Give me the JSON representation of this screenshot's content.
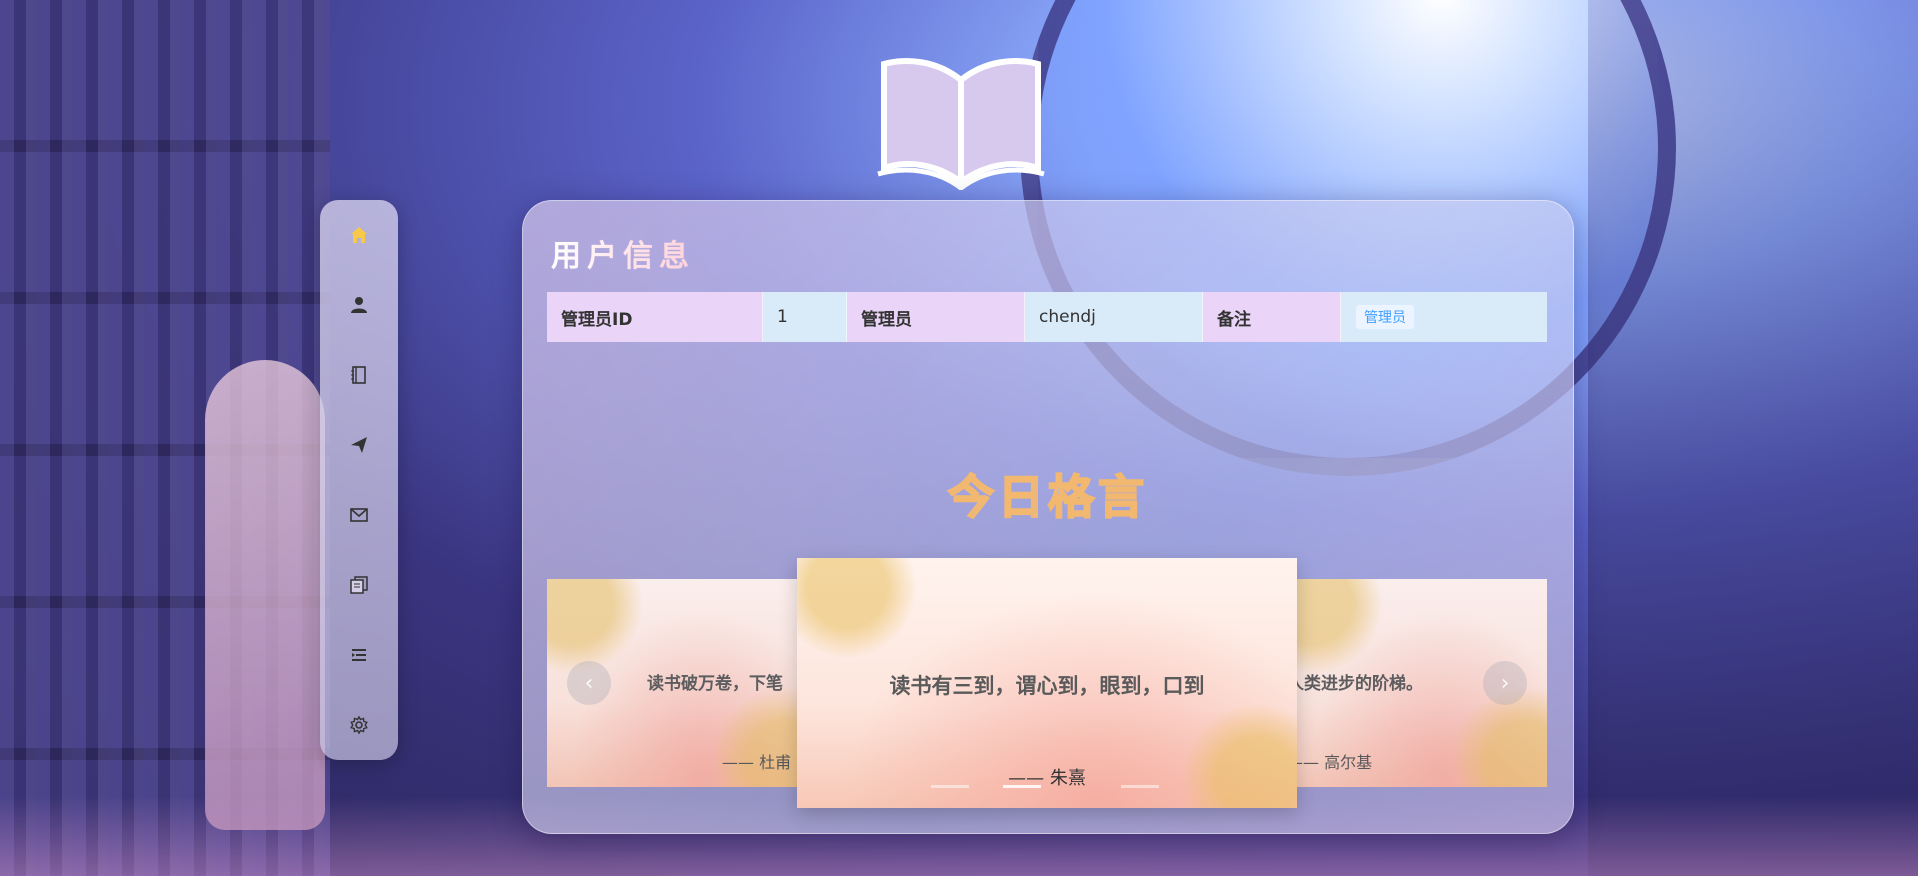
{
  "panel": {
    "title": "用户信息"
  },
  "info_table": [
    {
      "label": "管理员ID",
      "value": "1"
    },
    {
      "label": "管理员",
      "value": "chendj"
    },
    {
      "label": "备注",
      "tag": "管理员"
    }
  ],
  "motto": {
    "heading": "今日格言",
    "cards": [
      {
        "quote": "读书破万卷，下笔",
        "author": "—— 杜甫"
      },
      {
        "quote": "读书有三到，谓心到，眼到，口到",
        "author": "—— 朱熹"
      },
      {
        "quote": "人类进步的阶梯。",
        "author": "—— 高尔基"
      }
    ],
    "prev_icon": "chevron-left-icon",
    "next_icon": "chevron-right-icon",
    "active_index": 1
  },
  "sidebar": {
    "items": [
      {
        "icon": "home-icon",
        "active": true
      },
      {
        "icon": "user-icon"
      },
      {
        "icon": "notebook-icon"
      },
      {
        "icon": "send-icon"
      },
      {
        "icon": "mail-icon"
      },
      {
        "icon": "copy-icon"
      },
      {
        "icon": "list-icon"
      },
      {
        "icon": "gear-icon"
      }
    ]
  },
  "colors": {
    "active_icon": "#f7c948",
    "icon": "#333333",
    "label_cell": "#ead4f8",
    "value_cell": "#d9eaf8",
    "tag_text": "#409eff"
  }
}
